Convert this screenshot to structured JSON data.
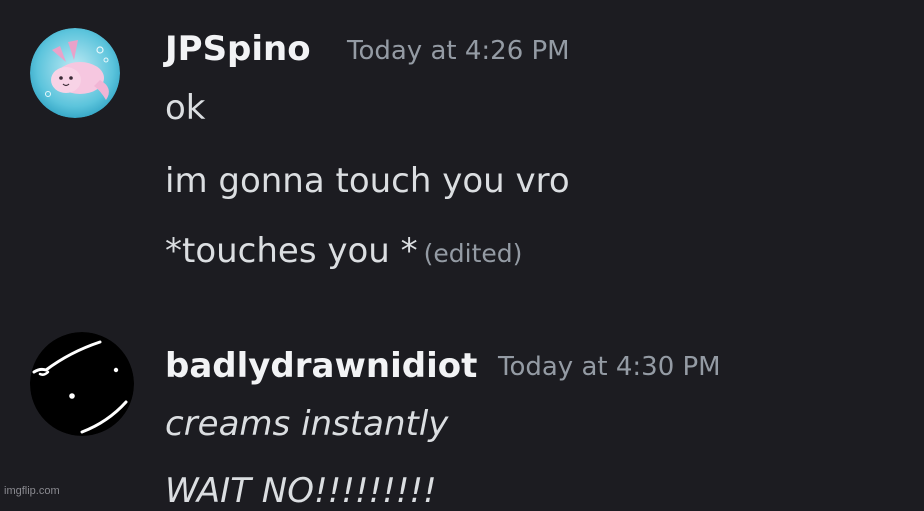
{
  "messages": [
    {
      "author": "JPSpino",
      "timestamp": "Today at 4:26 PM",
      "avatar_icon": "axolotl-avatar-icon",
      "lines": [
        {
          "text": "ok"
        },
        {
          "text": "im gonna touch you vro"
        },
        {
          "text": "*touches you *",
          "edited_label": "(edited)"
        }
      ]
    },
    {
      "author": "badlydrawnidiot",
      "timestamp": "Today at 4:30 PM",
      "avatar_icon": "scribble-face-avatar-icon",
      "lines": [
        {
          "text": "creams instantly"
        },
        {
          "text": "WAIT NO!!!!!!!!!"
        }
      ]
    }
  ],
  "watermark": "imgflip.com",
  "colors": {
    "background": "#1c1c21",
    "username": "#f2f3f5",
    "timestamp": "#949ba4",
    "message_text": "#dbdee1"
  }
}
